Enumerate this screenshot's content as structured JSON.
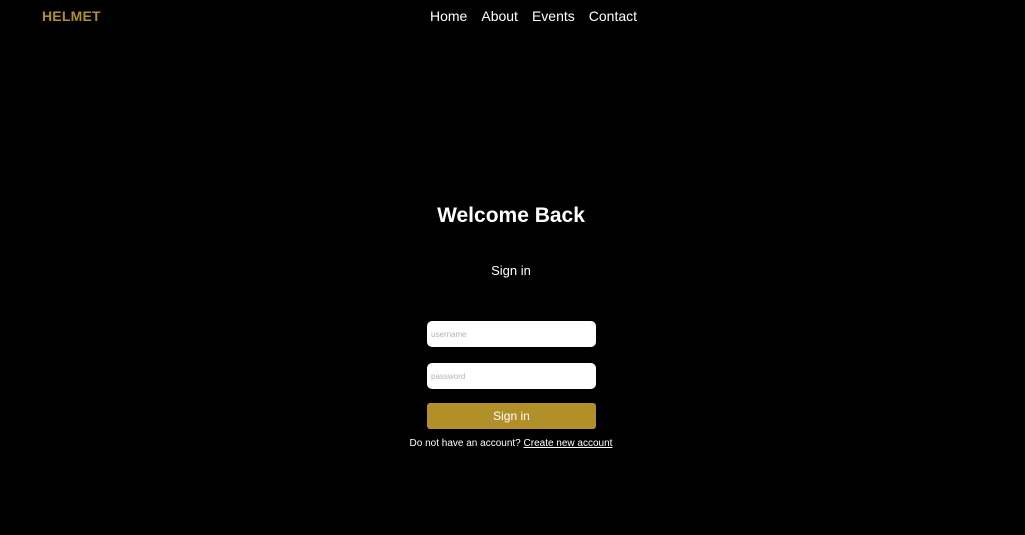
{
  "colors": {
    "background": "#000000",
    "brand_gold": "#b1902a",
    "text": "#ffffff",
    "input_background": "#ffffff"
  },
  "navbar": {
    "logo": "HELMET",
    "links": [
      {
        "label": "Home"
      },
      {
        "label": "About"
      },
      {
        "label": "Events"
      },
      {
        "label": "Contact"
      }
    ]
  },
  "login": {
    "heading": "Welcome Back",
    "subheading": "Sign in",
    "username": {
      "placeholder": "username",
      "value": ""
    },
    "password": {
      "placeholder": "password",
      "value": ""
    },
    "submit_label": "Sign in",
    "signup_prompt": "Do not have an account?",
    "signup_link": "Create new account"
  }
}
